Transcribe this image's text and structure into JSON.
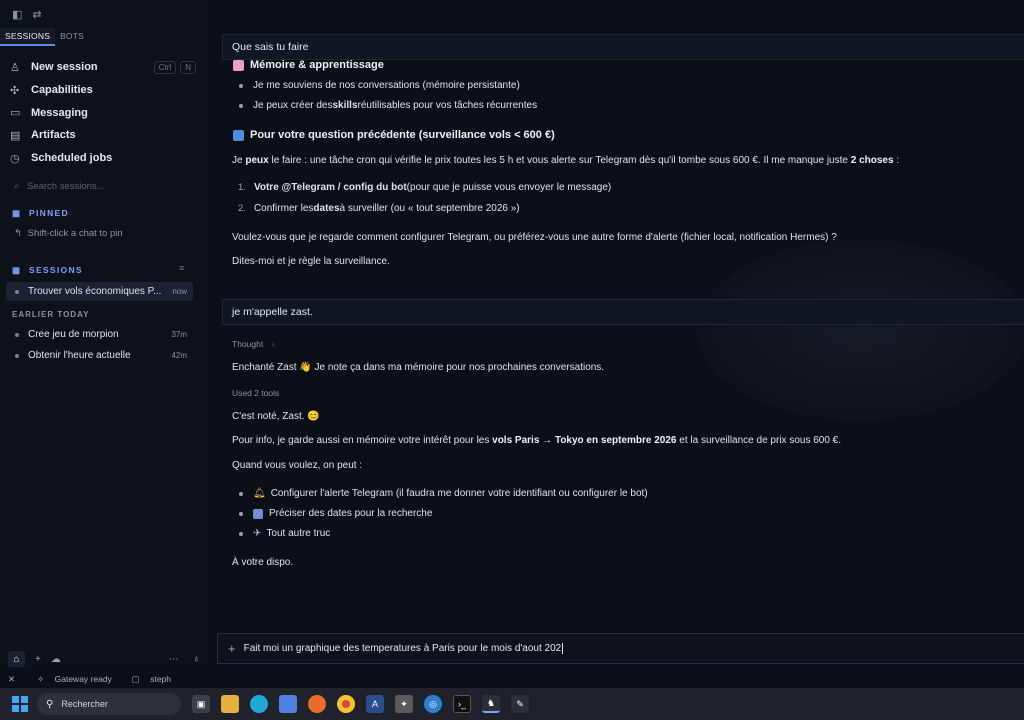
{
  "sidebar": {
    "tabs": [
      "SESSIONS",
      "BOTS"
    ],
    "nav": [
      {
        "icon": "user-icon",
        "label": "New session",
        "shortcut": [
          "Ctrl",
          "N"
        ]
      },
      {
        "icon": "puzzle-icon",
        "label": "Capabilities"
      },
      {
        "icon": "chat-bubble-icon",
        "label": "Messaging"
      },
      {
        "icon": "document-icon",
        "label": "Artifacts"
      },
      {
        "icon": "clock-icon",
        "label": "Scheduled jobs"
      }
    ],
    "search_placeholder": "Search sessions...",
    "pinned_header": "PINNED",
    "pinned_hint": "Shift-click a chat to pin",
    "sessions_header": "SESSIONS",
    "current_session": {
      "title": "Trouver vols économiques P...",
      "age": "now"
    },
    "earlier_header": "EARLIER TODAY",
    "earlier_sessions": [
      {
        "title": "Cree jeu de morpion",
        "age": "37m"
      },
      {
        "title": "Obtenir l'heure actuelle",
        "age": "42m"
      }
    ]
  },
  "status_bar": {
    "gateway": "Gateway ready",
    "user": "steph"
  },
  "chat": {
    "user_msg_1": "Que sais tu faire",
    "section_memory": "Mémoire & apprentissage",
    "memory_bullets": [
      "Je me souviens de nos conversations (mémoire persistante)",
      {
        "pre": "Je peux créer des ",
        "bold": "skills",
        "post": " réutilisables pour vos tâches récurrentes"
      }
    ],
    "section_question": "Pour votre question précédente (surveillance vols < 600 €)",
    "para_1": {
      "pre": "Je ",
      "bold1": "peux",
      "mid": " le faire : une tâche cron qui vérifie le prix toutes les 5 h et vous alerte sur Telegram dès qu'il tombe sous 600 €. Il me manque juste ",
      "bold2": "2 choses",
      "post": " :"
    },
    "numbered": [
      {
        "n": "1.",
        "bold": "Votre @Telegram / config du bot",
        "post": " (pour que je puisse vous envoyer le message)"
      },
      {
        "n": "2.",
        "pre": "Confirmer les ",
        "bold": "dates",
        "post": " à surveiller (ou « tout septembre 2026 »)"
      }
    ],
    "para_2": "Voulez-vous que je regarde comment configurer Telegram, ou préférez-vous une autre forme d'alerte (fichier local, notification Hermes) ?",
    "para_3": "Dites-moi et je règle la surveillance.",
    "user_msg_2": "je m'appelle zast.",
    "thought_label": "Thought",
    "reply_1": "Enchanté Zast 👋 Je note ça dans ma mémoire pour nos prochaines conversations.",
    "tools_label": "Used 2 tools",
    "reply_2": "C'est noté, Zast. 😊",
    "reply_3": {
      "pre": "Pour info, je garde aussi en mémoire votre intérêt pour les ",
      "bold": "vols Paris → Tokyo en septembre 2026",
      "post": " et la surveillance de prix sous 600 €."
    },
    "reply_4": "Quand vous voulez, on peut :",
    "options": [
      {
        "icon": "bell-icon",
        "text": "Configurer l'alerte Telegram (il faudra me donner votre identifiant ou configurer le bot)"
      },
      {
        "icon": "calendar-icon",
        "text": "Préciser des dates pour la recherche"
      },
      {
        "icon": "airplane-icon",
        "text": "Tout autre truc"
      }
    ],
    "reply_5": "À votre dispo."
  },
  "composer": {
    "value": "Fait moi un graphique des temperatures à Paris pour le mois d'aout 202"
  },
  "taskbar": {
    "search_placeholder": "Rechercher"
  },
  "colors": {
    "accent": "#5b8cff",
    "background": "#0b0f16",
    "sidebar": "#0d1219"
  }
}
